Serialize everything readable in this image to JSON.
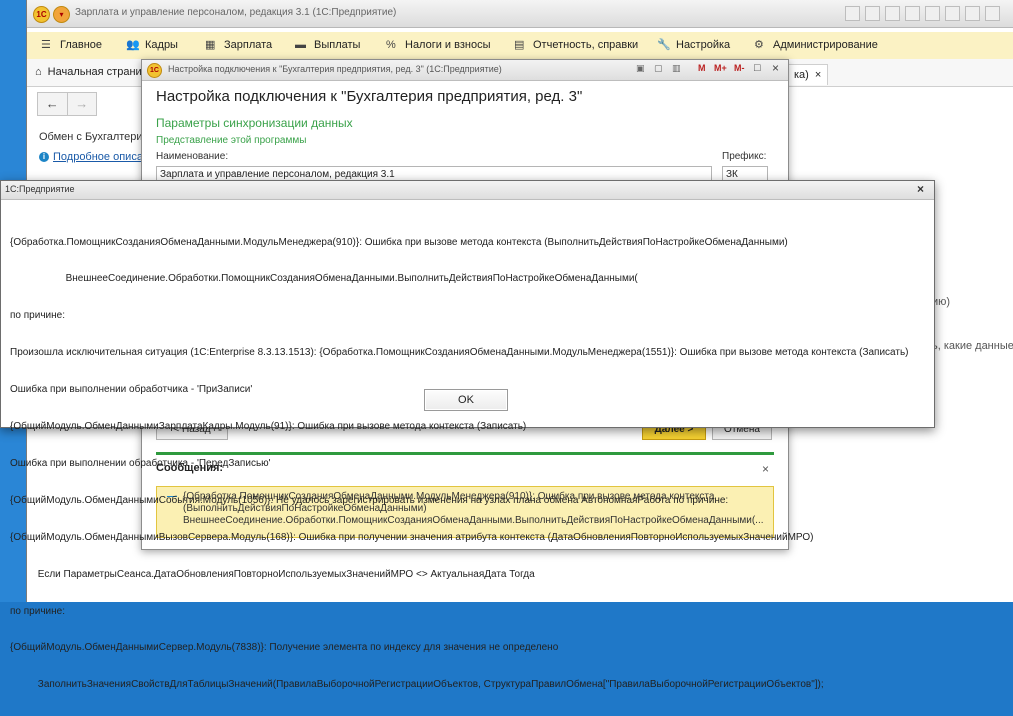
{
  "app": {
    "title": "Зарплата и управление персоналом, редакция 3.1  (1С:Предприятие)",
    "logo_text": "1С"
  },
  "menu": {
    "items": [
      {
        "label": "Главное",
        "icon": "menu-icon"
      },
      {
        "label": "Кадры",
        "icon": "people-icon"
      },
      {
        "label": "Зарплата",
        "icon": "calculator-icon"
      },
      {
        "label": "Выплаты",
        "icon": "wallet-icon"
      },
      {
        "label": "Налоги и взносы",
        "icon": "percent-icon"
      },
      {
        "label": "Отчетность, справки",
        "icon": "report-icon"
      },
      {
        "label": "Настройка",
        "icon": "wrench-icon"
      },
      {
        "label": "Администрирование",
        "icon": "gear-icon"
      }
    ]
  },
  "tabs": {
    "home_label": "Начальная страни",
    "right_tab_label": "ка)"
  },
  "background": {
    "exchange_label": "Обмен с Бухгалтери",
    "link_label": "Подробное описан",
    "right_text_1": "ию)",
    "right_text_2": "ь, какие данные"
  },
  "settings_dialog": {
    "window_title": "Настройка подключения к \"Бухгалтерия предприятия, ред. 3\"  (1С:Предприятие)",
    "heading": "Настройка подключения к \"Бухгалтерия предприятия, ред. 3\"",
    "section_title": "Параметры синхронизации данных",
    "subsection_title": "Представление этой программы",
    "name_label": "Наименование:",
    "name_value": "Зарплата и управление персоналом, редакция 3.1",
    "prefix_label": "Префикс:",
    "prefix_value": "ЗК",
    "back_button": "< Назад",
    "next_button": "Далее >",
    "cancel_button": "Отмена",
    "messages_title": "Сообщения:",
    "message_text": "{Обработка.ПомощникСозданияОбменаДанными.МодульМенеджера(910)}: Ошибка при вызове метода контекста (ВыполнитьДействияПоНастройкеОбменаДанными)\n    ВнешнееСоединение.Обработки.ПомощникСозданияОбменаДанными.ВыполнитьДействияПоНастройкеОбменаДанными(...",
    "title_buttons": [
      "M",
      "M+",
      "M-"
    ]
  },
  "error_dialog": {
    "title": "1С:Предприятие",
    "ok_button": "OK",
    "lines": [
      "{Обработка.ПомощникСозданияОбменаДанными.МодульМенеджера(910)}: Ошибка при вызове метода контекста (ВыполнитьДействияПоНастройкеОбменаДанными)",
      "                    ВнешнееСоединение.Обработки.ПомощникСозданияОбменаДанными.ВыполнитьДействияПоНастройкеОбменаДанными(",
      "по причине:",
      "Произошла исключительная ситуация (1C:Enterprise 8.3.13.1513): {Обработка.ПомощникСозданияОбменаДанными.МодульМенеджера(1551)}: Ошибка при вызове метода контекста (Записать)",
      "Ошибка при выполнении обработчика - 'ПриЗаписи'",
      "{ОбщийМодуль.ОбменДаннымиЗарплатаКадры.Модуль(91)}: Ошибка при вызове метода контекста (Записать)",
      "Ошибка при выполнении обработчика - 'ПередЗаписью'",
      "{ОбщийМодуль.ОбменДаннымиСобытия.Модуль(1056)}: Не удалось зарегистрировать изменения на узлах плана обмена АвтономнаяРабота по причине:",
      "{ОбщийМодуль.ОбменДаннымиВызовСервера.Модуль(168)}: Ошибка при получении значения атрибута контекста (ДатаОбновленияПовторноИспользуемыхЗначенийМРО)",
      "          Если ПараметрыСеанса.ДатаОбновленияПовторноИспользуемыхЗначенийМРО <> АктуальнаяДата Тогда",
      "по причине:",
      "{ОбщийМодуль.ОбменДаннымиСервер.Модуль(7838)}: Получение элемента по индексу для значения не определено",
      "          ЗаполнитьЗначенияСвойствДляТаблицыЗначений(ПравилаВыборочнойРегистрацииОбъектов, СтруктураПравилОбмена[\"ПравилаВыборочнойРегистрацииОбъектов\"]);"
    ]
  }
}
